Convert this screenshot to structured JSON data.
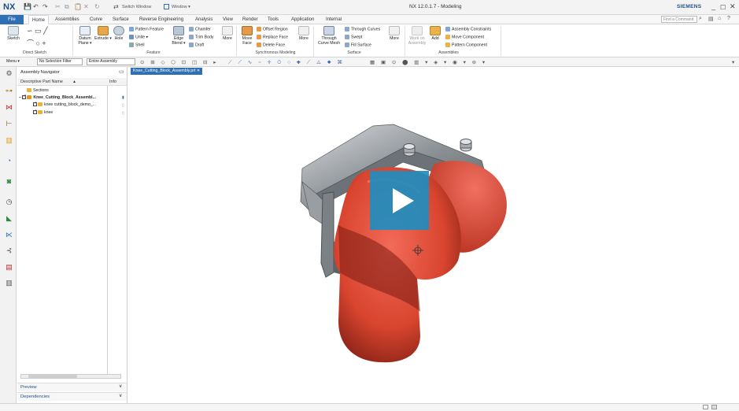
{
  "app": {
    "logo": "NX",
    "title": "NX 12.0.1.7 - Modeling",
    "brand": "SIEMENS",
    "switch_window": "Switch Window",
    "window_menu": "Window ▾",
    "search_placeholder": "Find a Command"
  },
  "tabs": [
    "File",
    "Home",
    "Assemblies",
    "Curve",
    "Surface",
    "Reverse Engineering",
    "Analysis",
    "View",
    "Render",
    "Tools",
    "Application",
    "Internal"
  ],
  "ribbon": {
    "direct_sketch": {
      "sketch": "Sketch",
      "label": "Direct Sketch"
    },
    "feature": {
      "datum_plane": "Datum Plane ▾",
      "extrude": "Extrude ▾",
      "hole": "Hole",
      "pattern_feature": "Pattern Feature",
      "unite": "Unite ▾",
      "shell": "Shell",
      "edge_blend": "Edge Blend ▾",
      "chamfer": "Chamfer",
      "trim_body": "Trim Body",
      "draft": "Draft",
      "more": "More",
      "label": "Feature"
    },
    "sync": {
      "move_face": "Move Face",
      "offset_region": "Offset Region",
      "replace_face": "Replace Face",
      "delete_face": "Delete Face",
      "more": "More",
      "label": "Synchronous Modeling"
    },
    "surface": {
      "through_curve_mesh": "Through Curve Mesh",
      "through_curves": "Through Curves",
      "swept": "Swept",
      "fill_surface": "Fill Surface",
      "more": "More",
      "label": "Surface"
    },
    "assemblies": {
      "work_on_assembly": "Work on Assembly",
      "add": "Add",
      "assembly_constraints": "Assembly Constraints",
      "move_component": "Move Component",
      "pattern_component": "Pattern Component",
      "label": "Assemblies"
    }
  },
  "toolbar": {
    "menu": "Menu ▾",
    "selection_filter": "No Selection Filter",
    "assembly_scope": "Entire Assembly"
  },
  "navigator": {
    "title": "Assembly Navigator",
    "col_name": "Descriptive Part Name",
    "col_sort": "▲",
    "col_info": "Info",
    "tree": [
      {
        "label": "Sections",
        "level": 0
      },
      {
        "label": "Knee_Cutting_Block_Assembl...",
        "level": 0
      },
      {
        "label": "knee cutting_block_demo_...",
        "level": 1
      },
      {
        "label": "knee",
        "level": 1
      }
    ],
    "preview": "Preview",
    "dependencies": "Dependencies"
  },
  "document_tab": "Knee_Cutting_Block_Assembly.prt ✕",
  "colors": {
    "accent": "#2f6fb4",
    "play_button": "#1f8dbf",
    "knee_model": "#e24a3c",
    "cutting_block": "#9ea2a6"
  }
}
